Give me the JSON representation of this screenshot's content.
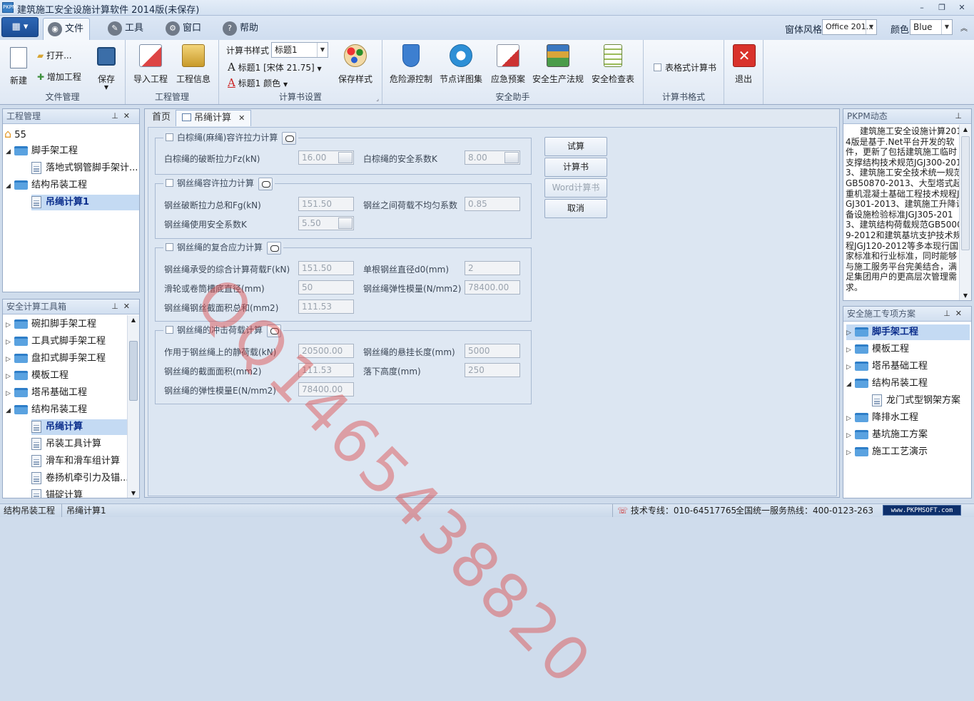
{
  "window": {
    "title": "建筑施工安全设施计算软件 2014版(未保存)",
    "icon": "app-icon",
    "min": "–",
    "restore": "❐",
    "close": "✕"
  },
  "menu_tabs": [
    {
      "label": "文件",
      "icon": "file-icon"
    },
    {
      "label": "工具",
      "icon": "wrench-icon"
    },
    {
      "label": "窗口",
      "icon": "gear-icon"
    },
    {
      "label": "帮助",
      "icon": "help-icon"
    }
  ],
  "style_controls": {
    "window_style_label": "窗体风格",
    "window_style_value": "Office 201...",
    "color_label": "颜色",
    "color_value": "Blue"
  },
  "ribbon": {
    "file_group": {
      "label": "文件管理",
      "new": "新建",
      "open": "打开...",
      "add_project": "增加工程",
      "save": "保存"
    },
    "project_group": {
      "label": "工程管理",
      "import": "导入工程",
      "info": "工程信息"
    },
    "calc_book_group": {
      "label": "计算书设置",
      "style_label": "计算书样式",
      "style_value": "标题1",
      "font_item": "标题1 [宋体 21.75]",
      "color_item": "标题1 颜色",
      "save_style": "保存样式"
    },
    "safety_group": {
      "label": "安全助手",
      "items": [
        "危险源控制",
        "节点详图集",
        "应急预案",
        "安全生产法规",
        "安全检查表"
      ]
    },
    "format_group": {
      "label": "计算书格式",
      "table_format": "表格式计算书"
    },
    "exit": "退出"
  },
  "project_panel": {
    "title": "工程管理",
    "root": "55",
    "nodes": [
      {
        "label": "脚手架工程",
        "kind": "folder"
      },
      {
        "label": "落地式钢管脚手架计...",
        "kind": "doc"
      },
      {
        "label": "结构吊装工程",
        "kind": "folder"
      },
      {
        "label": "吊绳计算1",
        "kind": "doc"
      }
    ]
  },
  "toolbox_panel": {
    "title": "安全计算工具箱",
    "nodes": [
      {
        "label": "碗扣脚手架工程",
        "kind": "folder"
      },
      {
        "label": "工具式脚手架工程",
        "kind": "folder"
      },
      {
        "label": "盘扣式脚手架工程",
        "kind": "folder"
      },
      {
        "label": "模板工程",
        "kind": "folder"
      },
      {
        "label": "塔吊基础工程",
        "kind": "folder"
      },
      {
        "label": "结构吊装工程",
        "kind": "folder"
      },
      {
        "label": "吊绳计算",
        "kind": "doc"
      },
      {
        "label": "吊装工具计算",
        "kind": "doc"
      },
      {
        "label": "滑车和滑车组计算",
        "kind": "doc"
      },
      {
        "label": "卷扬机牵引力及锚...",
        "kind": "doc"
      },
      {
        "label": "锚碇计算",
        "kind": "doc"
      }
    ]
  },
  "doc_tabs": {
    "home": "首页",
    "active": "吊绳计算",
    "close": "✕"
  },
  "sections": [
    {
      "title": "白棕绳(麻绳)容许拉力计算",
      "fields": [
        {
          "label": "白棕绳的破断拉力Fz(kN)",
          "value": "16.00"
        },
        {
          "label": "白棕绳的安全系数K",
          "value": "8.00"
        }
      ]
    },
    {
      "title": "钢丝绳容许拉力计算",
      "fields": [
        {
          "label": "钢丝破断拉力总和Fg(kN)",
          "value": "151.50"
        },
        {
          "label": "钢丝之间荷载不均匀系数",
          "value": "0.85"
        },
        {
          "label": "钢丝绳使用安全系数K",
          "value": "5.50"
        }
      ]
    },
    {
      "title": "钢丝绳的复合应力计算",
      "fields": [
        {
          "label": "钢丝绳承受的综合计算荷载F(kN)",
          "value": "151.50"
        },
        {
          "label": "单根钢丝直径d0(mm)",
          "value": "2"
        },
        {
          "label": "滑轮或卷筒槽底直径(mm)",
          "value": "50"
        },
        {
          "label": "钢丝绳弹性模量(N/mm2)",
          "value": "78400.00"
        },
        {
          "label": "钢丝绳钢丝截面积总和(mm2)",
          "value": "111.53"
        }
      ]
    },
    {
      "title": "钢丝绳的冲击荷载计算",
      "fields": [
        {
          "label": "作用于钢丝绳上的静荷载(kN)",
          "value": "20500.00"
        },
        {
          "label": "钢丝绳的悬挂长度(mm)",
          "value": "5000"
        },
        {
          "label": "钢丝绳的截面面积(mm2)",
          "value": "111.53"
        },
        {
          "label": "落下高度(mm)",
          "value": "250"
        },
        {
          "label": "钢丝绳的弹性模量E(N/mm2)",
          "value": "78400.00"
        }
      ]
    }
  ],
  "actions": {
    "trial": "试算",
    "calc_book": "计算书",
    "word_book": "Word计算书",
    "cancel": "取消"
  },
  "news_panel": {
    "title": "PKPM动态",
    "text": "建筑施工安全设施计算2014版是基于.Net平台开发的软件，更新了包括建筑施工临时支撑结构技术规范JGJ300-2013、建筑施工安全技术统一规范GB50870-2013、大型塔式起重机混凝土基础工程技术规程JGJ301-2013、建筑施工升降设备设施检验标准JGJ305-2013、建筑结构荷载规范GB50009-2012和建筑基坑支护技术规程JGJ120-2012等多本现行国家标准和行业标准，同时能够与施工服务平台完美结合，满足集团用户的更高层次管理需求。"
  },
  "plans_panel": {
    "title": "安全施工专项方案",
    "nodes": [
      {
        "label": "脚手架工程",
        "kind": "folder"
      },
      {
        "label": "模板工程",
        "kind": "folder"
      },
      {
        "label": "塔吊基础工程",
        "kind": "folder"
      },
      {
        "label": "结构吊装工程",
        "kind": "folder"
      },
      {
        "label": "龙门式型钢架方案",
        "kind": "doc"
      },
      {
        "label": "降排水工程",
        "kind": "folder"
      },
      {
        "label": "基坑施工方案",
        "kind": "folder"
      },
      {
        "label": "施工工艺演示",
        "kind": "folder"
      }
    ]
  },
  "status": {
    "left1": "结构吊装工程",
    "left2": "吊绳计算1",
    "hotline1": "技术专线：010-64517765",
    "hotline2": "全国统一服务热线：400-0123-263",
    "site": "www.PKPMSOFT.com"
  },
  "watermark": "QQ1465438820",
  "colors": {
    "accent": "#1b4d95",
    "selection": "#c4daf3",
    "watermark": "#dc4646"
  }
}
